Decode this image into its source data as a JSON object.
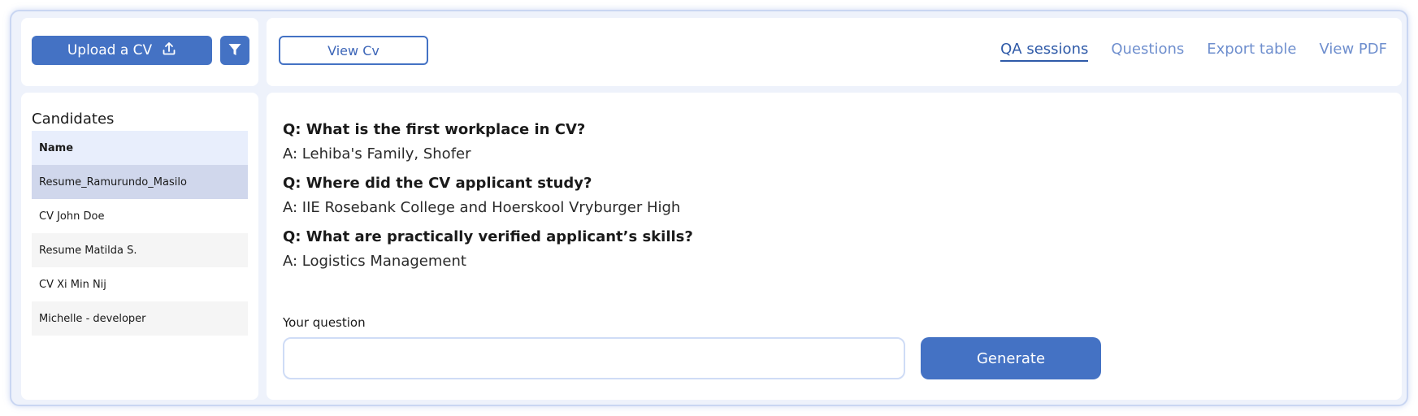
{
  "toolbar": {
    "upload_label": "Upload a CV",
    "view_cv_label": "View Cv"
  },
  "tabs": [
    {
      "label": "QA sessions",
      "active": true
    },
    {
      "label": "Questions",
      "active": false
    },
    {
      "label": "Export table",
      "active": false
    },
    {
      "label": "View PDF",
      "active": false
    }
  ],
  "candidates": {
    "title": "Candidates",
    "column_header": "Name",
    "rows": [
      {
        "name": "Resume_Ramurundo_Masilo",
        "selected": true
      },
      {
        "name": "CV John Doe",
        "selected": false
      },
      {
        "name": "Resume Matilda S.",
        "selected": false
      },
      {
        "name": "CV Xi Min Nij",
        "selected": false
      },
      {
        "name": "Michelle - developer",
        "selected": false
      }
    ]
  },
  "qa": [
    {
      "q": "Q: What is the first workplace in CV?",
      "a": "A: Lehiba's Family, Shofer"
    },
    {
      "q": "Q: Where did the CV applicant study?",
      "a": "A: IIE Rosebank College and Hoerskool Vryburger High"
    },
    {
      "q": "Q: What are practically verified applicant’s skills?",
      "a": "A: Logistics Management"
    }
  ],
  "question_input": {
    "label": "Your question",
    "value": "",
    "placeholder": ""
  },
  "generate_label": "Generate",
  "colors": {
    "accent": "#4472c4",
    "tab_active": "#2f5aa8",
    "tab_inactive": "#6f8fce",
    "selected_row": "#d0d7ec"
  },
  "icons": {
    "upload": "upload-icon",
    "filter": "filter-icon"
  }
}
